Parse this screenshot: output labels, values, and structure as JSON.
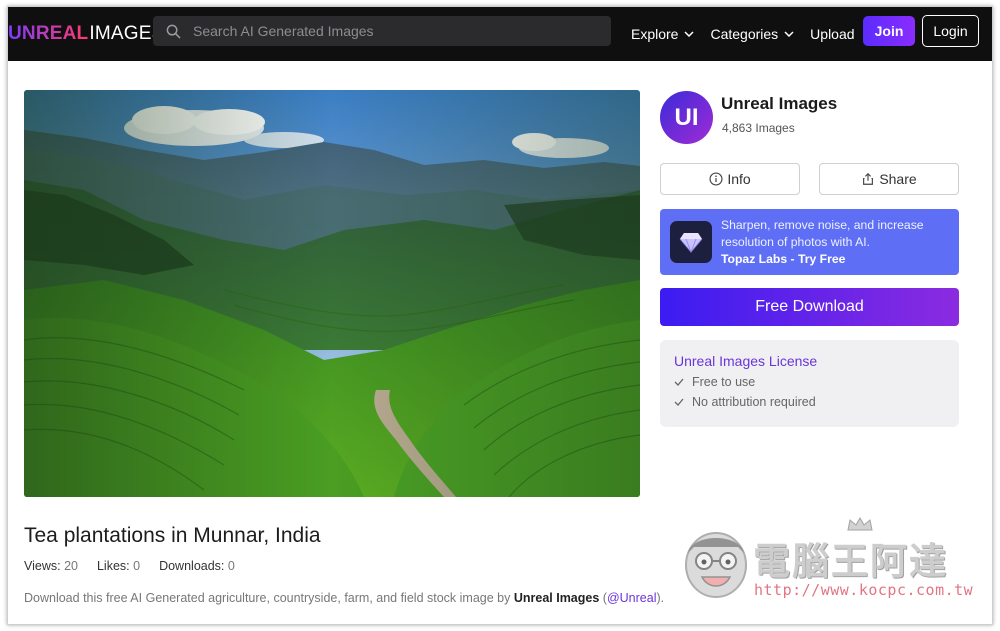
{
  "header": {
    "logo_part1": "UNREAL",
    "logo_part2": "IMAGES",
    "search_placeholder": "Search AI Generated Images",
    "nav": {
      "explore": "Explore",
      "categories": "Categories",
      "upload": "Upload"
    },
    "join_label": "Join",
    "login_label": "Login"
  },
  "profile": {
    "avatar_initials": "UI",
    "name": "Unreal Images",
    "image_count": "4,863 Images"
  },
  "actions": {
    "info_label": "Info",
    "share_label": "Share"
  },
  "promo": {
    "line1": "Sharpen, remove noise, and increase",
    "line2": "resolution of photos with AI.",
    "cta": "Topaz Labs - Try Free"
  },
  "download_label": "Free Download",
  "license": {
    "title": "Unreal Images License",
    "items": [
      "Free to use",
      "No attribution required"
    ]
  },
  "image_info": {
    "title": "Tea plantations in Munnar, India",
    "stats": [
      {
        "label": "Views:",
        "value": "20"
      },
      {
        "label": "Likes:",
        "value": "0"
      },
      {
        "label": "Downloads:",
        "value": "0"
      }
    ],
    "description_prefix": "Download this free AI Generated agriculture, countryside, farm, and field stock image by",
    "description_author": "Unreal Images",
    "description_handle": "@Unreal"
  },
  "watermark": {
    "name": "電腦王阿達",
    "url": "http://www.kocpc.com.tw"
  },
  "colors": {
    "header_bg": "#0f0f10",
    "accent_purple": "#6a35d8",
    "promo_bg": "#5e6ff5",
    "download_gradient_start": "#3b1cf2",
    "download_gradient_end": "#8b2be0"
  }
}
